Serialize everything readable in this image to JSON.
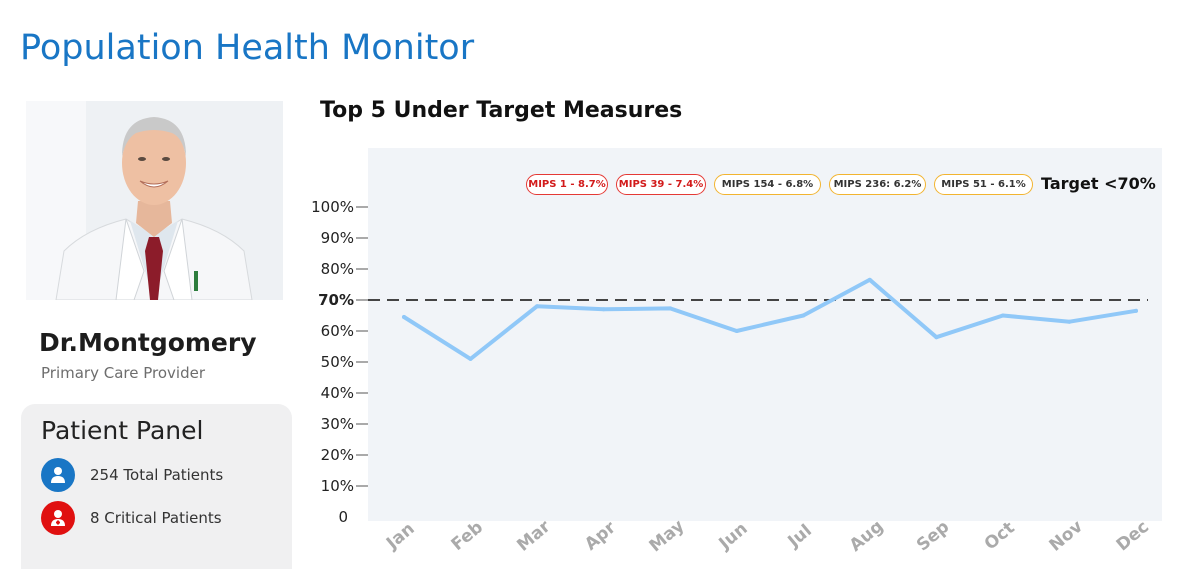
{
  "app_title": "Population Health Monitor",
  "provider": {
    "name": "Dr.Montgomery",
    "role": "Primary Care Provider"
  },
  "patient_panel": {
    "title": "Patient Panel",
    "stats": [
      {
        "label": "254 Total Patients",
        "icon": "user-icon",
        "color": "#1976c5"
      },
      {
        "label": "8 Critical Patients",
        "icon": "critical-user-icon",
        "color": "#e01010"
      }
    ]
  },
  "chart_section": {
    "title": "Top 5 Under Target Measures",
    "target_label": "Target <70%",
    "measures": [
      {
        "label": "MIPS 1 - 8.7%",
        "status": "red"
      },
      {
        "label": "MIPS 39 - 7.4%",
        "status": "red"
      },
      {
        "label": "MIPS 154 - 6.8%",
        "status": "orange"
      },
      {
        "label": "MIPS 236: 6.2%",
        "status": "orange"
      },
      {
        "label": "MIPS 51 - 6.1%",
        "status": "orange"
      }
    ]
  },
  "chart_data": {
    "type": "line",
    "categories": [
      "Jan",
      "Feb",
      "Mar",
      "Apr",
      "May",
      "Jun",
      "Jul",
      "Aug",
      "Sep",
      "Oct",
      "Nov",
      "Dec"
    ],
    "series": [
      {
        "values": [
          64.5,
          51,
          68,
          67,
          67.3,
          60,
          65,
          76.5,
          58,
          65,
          63,
          66.5
        ]
      }
    ],
    "target_value": 70,
    "ylim": [
      0,
      100
    ],
    "yticks": [
      0,
      10,
      20,
      30,
      40,
      50,
      60,
      70,
      80,
      90,
      100
    ],
    "ytick_labels": [
      "0",
      "10%",
      "20%",
      "30%",
      "40%",
      "50%",
      "60%",
      "70%",
      "80%",
      "90%",
      "100%"
    ],
    "colors": {
      "line": "#90c8f8",
      "target": "#444444",
      "plot_bg": "#f1f4f8"
    }
  }
}
